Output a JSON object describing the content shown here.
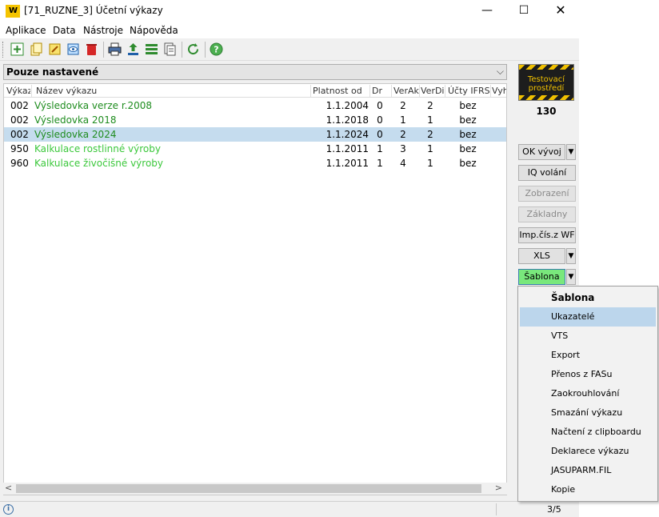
{
  "window": {
    "logo_text": "W",
    "title": "[71_RUZNE_3] Účetní výkazy",
    "minimize": "—",
    "maximize": "☐",
    "close": "✕"
  },
  "menu": [
    "Aplikace",
    "Data",
    "Nástroje",
    "Nápověda"
  ],
  "filter": {
    "label": "Pouze nastavené",
    "chevron": "⌵"
  },
  "grid": {
    "columns": [
      "Výkaz",
      "Název výkazu",
      "Platnost od",
      "Dr",
      "VerAk",
      "VerDi",
      "Účty IFRS",
      "Vyh"
    ],
    "rows": [
      {
        "code": "002",
        "name": "Výsledovka verze r.2008",
        "date": "1.1.2004",
        "dr": "0",
        "vera": "2",
        "verd": "2",
        "ucty": "bez",
        "color": "#1e8c1e",
        "selected": false
      },
      {
        "code": "002",
        "name": "Výsledovka 2018",
        "date": "1.1.2018",
        "dr": "0",
        "vera": "1",
        "verd": "1",
        "ucty": "bez",
        "color": "#1e8c1e",
        "selected": false
      },
      {
        "code": "002",
        "name": "Výsledovka 2024",
        "date": "1.1.2024",
        "dr": "0",
        "vera": "2",
        "verd": "2",
        "ucty": "bez",
        "color": "#1e8c1e",
        "selected": true
      },
      {
        "code": "950",
        "name": "Kalkulace rostlinné výroby",
        "date": "1.1.2011",
        "dr": "1",
        "vera": "3",
        "verd": "1",
        "ucty": "bez",
        "color": "#3cc83c",
        "selected": false
      },
      {
        "code": "960",
        "name": "Kalkulace živočišné výroby",
        "date": "1.1.2011",
        "dr": "1",
        "vera": "4",
        "verd": "1",
        "ucty": "bez",
        "color": "#3cc83c",
        "selected": false
      }
    ]
  },
  "scroll": {
    "left": "<",
    "right": ">"
  },
  "side": {
    "env_line1": "Testovací",
    "env_line2": "prostředí",
    "count": "130",
    "arrow": "▼",
    "buttons": {
      "ok_vyvoj": "OK vývoj",
      "iq_volani": "IQ volání",
      "zobrazeni": "Zobrazení",
      "zakladny": "Základny",
      "imp_cis": "Imp.čís.z WF",
      "xls": "XLS",
      "sablona": "Šablona"
    }
  },
  "dropdown": {
    "items": [
      "Šablona",
      "Ukazatelé",
      "VTS",
      "Export",
      "Přenos z FASu",
      "Zaokrouhlování",
      "Smazání výkazu",
      "Načtení z clipboardu",
      "Deklarece výkazu",
      "JASUPARM.FIL",
      "Kopie"
    ]
  },
  "status": {
    "info": "i",
    "pager": "3/5"
  }
}
